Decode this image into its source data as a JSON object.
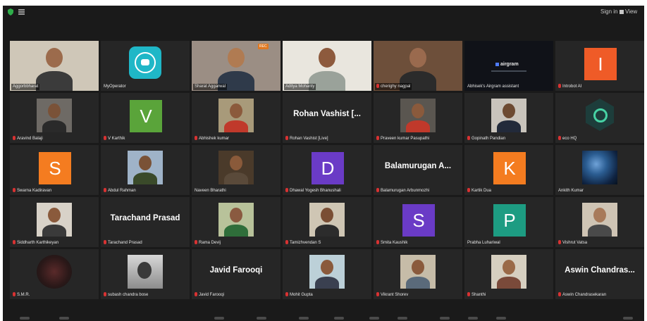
{
  "window": {
    "signin_label": "Sign in",
    "view_label": "View"
  },
  "tiles": [
    {
      "name": "Aggorbbharat",
      "kind": "video",
      "bg": "#cfc7b8",
      "face": "#9c6b4c",
      "body": "#3b3b3b",
      "mic": false,
      "overlay": true
    },
    {
      "name": "MyOperator",
      "kind": "phone",
      "mic": false,
      "overlay": false
    },
    {
      "name": "Sharat Aggarwal",
      "kind": "video",
      "bg": "#9b8e84",
      "face": "#b07b52",
      "body": "#2f3a4a",
      "mic": false,
      "overlay": true,
      "badge": "REC"
    },
    {
      "name": "Aditya Mohanty",
      "kind": "video",
      "bg": "#e9e6de",
      "face": "#8d5a3d",
      "body": "#9aa29a",
      "mic": false,
      "overlay": true,
      "active": true
    },
    {
      "name": "cherighy nagpal",
      "kind": "video",
      "bg": "#6d4f3a",
      "face": "#9a6a4e",
      "body": "#2b2b2b",
      "mic": true,
      "overlay": true
    },
    {
      "name": "Abhisek's Airgram assistant",
      "kind": "airgram",
      "logo": "airgram",
      "mic": false,
      "overlay": false
    },
    {
      "name": "Introbot AI",
      "kind": "square",
      "letter": "I",
      "color": "#ef5b27",
      "mic": true,
      "overlay": false
    },
    {
      "name": "Aravind Balaji",
      "kind": "head",
      "bg": "#6e6a65",
      "face": "#7a5238",
      "body": "#2a2a2a",
      "mic": true,
      "overlay": false
    },
    {
      "name": "V Karthik",
      "kind": "square",
      "letter": "V",
      "color": "#5aa43a",
      "mic": true,
      "overlay": false
    },
    {
      "name": "Abhishek kumar",
      "kind": "head",
      "bg": "#a89a7a",
      "face": "#8b5a3c",
      "body": "#c0392b",
      "mic": true,
      "overlay": false
    },
    {
      "name": "Rohan Vashist [Live]",
      "kind": "name",
      "big": "Rohan Vashist [...",
      "mic": true,
      "overlay": false
    },
    {
      "name": "Praveen kumar Pasupathi",
      "kind": "head",
      "bg": "#5a5650",
      "face": "#8a5a3c",
      "body": "#c0392b",
      "mic": true,
      "overlay": false
    },
    {
      "name": "Gopinath Pandian",
      "kind": "head",
      "bg": "#c9c4bc",
      "face": "#6d4a32",
      "body": "#222a3a",
      "mic": true,
      "overlay": false
    },
    {
      "name": "eco HQ",
      "kind": "hex",
      "mic": true,
      "overlay": false
    },
    {
      "name": "Swarna Kadiravan",
      "kind": "square",
      "letter": "S",
      "color": "#f47c20",
      "mic": true,
      "overlay": false
    },
    {
      "name": "Abdul Rahman",
      "kind": "head",
      "bg": "#9fb3c8",
      "face": "#7a5236",
      "body": "#3a4a2a",
      "mic": true,
      "overlay": false
    },
    {
      "name": "Naveen Bharathi",
      "kind": "head",
      "bg": "#4a3a2a",
      "face": "#8a5a3a",
      "body": "#5a4a3a",
      "mic": false,
      "overlay": false
    },
    {
      "name": "Dhawal Yogesh Bhanushali",
      "kind": "square",
      "letter": "D",
      "color": "#6a3bc6",
      "mic": true,
      "overlay": false
    },
    {
      "name": "Balamurugan Arbunmozhi",
      "kind": "name",
      "big": "Balamurugan A...",
      "mic": true,
      "overlay": false
    },
    {
      "name": "Kartik Dua",
      "kind": "square",
      "letter": "K",
      "color": "#f47c20",
      "mic": true,
      "overlay": false
    },
    {
      "name": "Ankith Kumar",
      "kind": "brain",
      "mic": false,
      "overlay": false
    },
    {
      "name": "Siddharth Karthikeyan",
      "kind": "head",
      "bg": "#d8d2c8",
      "face": "#8a5a3c",
      "body": "#3a3a3a",
      "mic": true,
      "overlay": false
    },
    {
      "name": "Tarachand Prasad",
      "kind": "name",
      "big": "Tarachand Prasad",
      "mic": true,
      "overlay": false
    },
    {
      "name": "Rama Devij",
      "kind": "head",
      "bg": "#b8c29a",
      "face": "#8a5a40",
      "body": "#2f6e3a",
      "mic": true,
      "overlay": false
    },
    {
      "name": "Tamizhvendan S",
      "kind": "head",
      "bg": "#cfc6b4",
      "face": "#7a4e34",
      "body": "#2c2c2c",
      "mic": true,
      "overlay": false
    },
    {
      "name": "Smita Kaushik",
      "kind": "square",
      "letter": "S",
      "color": "#6a3bc6",
      "mic": true,
      "overlay": false
    },
    {
      "name": "Prabha Luhariwal",
      "kind": "square",
      "letter": "P",
      "color": "#1d9c82",
      "mic": false,
      "overlay": false
    },
    {
      "name": "Vishrut Vatsa",
      "kind": "head",
      "bg": "#cfc4b4",
      "face": "#a87a5a",
      "body": "#4a4a4a",
      "mic": true,
      "overlay": false
    },
    {
      "name": "S.M.R.",
      "kind": "eco",
      "mic": true,
      "overlay": false
    },
    {
      "name": "subash chandra bose",
      "kind": "sketch",
      "mic": true,
      "overlay": false
    },
    {
      "name": "Javid Farooqi",
      "kind": "name",
      "big": "Javid Farooqi",
      "mic": true,
      "overlay": false
    },
    {
      "name": "Mohit Gupta",
      "kind": "head",
      "bg": "#bcd0d8",
      "face": "#8a5a3c",
      "body": "#3a4050",
      "mic": true,
      "overlay": false
    },
    {
      "name": "Vikrant Shorev",
      "kind": "head",
      "bg": "#c6bca8",
      "face": "#8a5a3c",
      "body": "#5a6a7a",
      "mic": true,
      "overlay": false
    },
    {
      "name": "Shanthi",
      "kind": "head",
      "bg": "#d6cfc0",
      "face": "#9a6a48",
      "body": "#7a4a3a",
      "mic": true,
      "overlay": false
    },
    {
      "name": "Aswin Chandrasekaran",
      "kind": "name",
      "big": "Aswin Chandras...",
      "mic": true,
      "overlay": false
    }
  ]
}
